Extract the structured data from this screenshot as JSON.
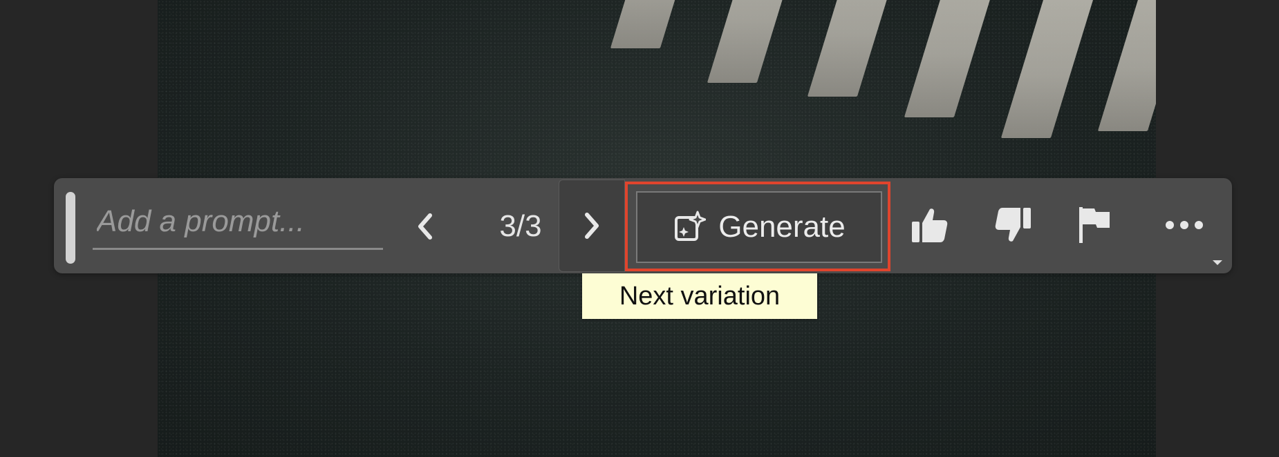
{
  "toolbar": {
    "prompt_placeholder": "Add a prompt...",
    "prompt_value": "",
    "variation_counter": "3/3",
    "generate_label": "Generate",
    "tooltip_text": "Next variation",
    "highlight_color": "#e0442d"
  },
  "icons": {
    "prev": "chevron-left-icon",
    "next": "chevron-right-icon",
    "generate": "generate-sparkle-icon",
    "thumbs_up": "thumbs-up-icon",
    "thumbs_down": "thumbs-down-icon",
    "flag": "flag-icon",
    "more": "more-horizontal-icon"
  }
}
